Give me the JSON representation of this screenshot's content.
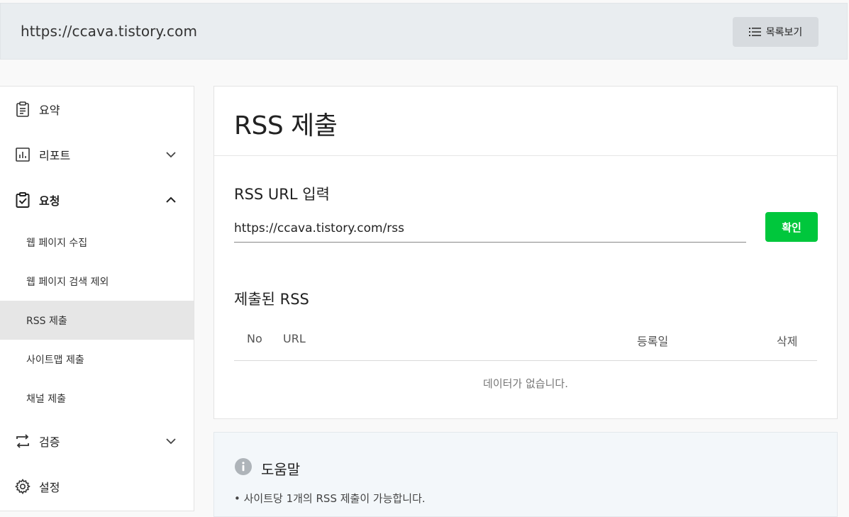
{
  "header": {
    "site_url": "https://ccava.tistory.com",
    "list_button_label": "목록보기",
    "list_icon": "list-icon"
  },
  "sidebar": {
    "items": [
      {
        "label": "요약",
        "icon": "clipboard-icon"
      },
      {
        "label": "리포트",
        "icon": "bar-chart-icon",
        "expanded": false
      },
      {
        "label": "요청",
        "icon": "clipboard-check-icon",
        "expanded": true
      },
      {
        "label": "검증",
        "icon": "swap-arrows-icon",
        "expanded": false
      },
      {
        "label": "설정",
        "icon": "gear-icon"
      }
    ],
    "sub_items": [
      {
        "label": "웹 페이지 수집"
      },
      {
        "label": "웹 페이지 검색 제외"
      },
      {
        "label": "RSS 제출",
        "active": true
      },
      {
        "label": "사이트맵 제출"
      },
      {
        "label": "채널 제출"
      }
    ]
  },
  "main": {
    "title": "RSS 제출",
    "input_section_title": "RSS URL 입력",
    "rss_url_value": "https://ccava.tistory.com/rss",
    "confirm_label": "확인",
    "submitted_title": "제출된 RSS",
    "table_headers": {
      "no": "No",
      "url": "URL",
      "date": "등록일",
      "delete": "삭제"
    },
    "empty_message": "데이터가 없습니다."
  },
  "help": {
    "title": "도움말",
    "line1": "• 사이트당 1개의 RSS 제출이 가능합니다."
  },
  "colors": {
    "accent_green": "#00c73c",
    "topbar_bg": "#e9edf0",
    "help_bg": "#f3f7fa"
  }
}
